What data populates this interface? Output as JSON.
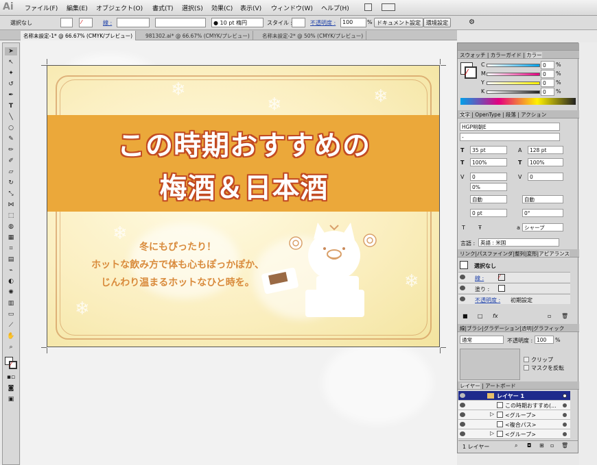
{
  "app": {
    "logo": "Ai"
  },
  "menu": [
    "ファイル(F)",
    "編集(E)",
    "オブジェクト(O)",
    "書式(T)",
    "選択(S)",
    "効果(C)",
    "表示(V)",
    "ウィンドウ(W)",
    "ヘルプ(H)"
  ],
  "control": {
    "selection": "選択なし",
    "stroke_label": "線 :",
    "brush_value": "10 pt 楕円",
    "style_label": "スタイル :",
    "opacity_label": "不透明度 :",
    "opacity_value": "100",
    "percent": "%",
    "doc_setup": "ドキュメント設定",
    "prefs": "環境設定"
  },
  "tabs": [
    {
      "label": "名称未設定-1* @ 66.67% (CMYK/プレビュー)",
      "active": true
    },
    {
      "label": "981302.ai* @ 66.67% (CMYK/プレビュー)",
      "active": false
    },
    {
      "label": "名称未設定-2* @ 50% (CMYK/プレビュー)",
      "active": false
    }
  ],
  "artwork": {
    "title_line1": "この時期おすすめの",
    "title_line2": "梅酒＆日本酒",
    "sub1": "冬にもぴったり！",
    "sub2": "ホットな飲み方で体も心もぽっかぽか、",
    "sub3": "じんわり温まるホットなひと時を。",
    "band_color": "#eba83a",
    "title_outline": "#c24a22",
    "sub_color": "#d98b3c"
  },
  "swatch_panel": {
    "tabs": [
      "スウォッチ",
      "カラーガイド",
      "カラー"
    ],
    "rows": [
      {
        "label": "C",
        "value": "0",
        "color": "#00a0e9"
      },
      {
        "label": "M",
        "value": "0",
        "color": "#e4007f"
      },
      {
        "label": "Y",
        "value": "0",
        "color": "#fff100"
      },
      {
        "label": "K",
        "value": "0",
        "color": "#222222"
      }
    ],
    "percent": "%"
  },
  "char_panel": {
    "tabs": [
      "文字",
      "OpenType",
      "段落",
      "アクション"
    ],
    "font": "HGP明朝E",
    "style": "-",
    "size": "35 pt",
    "leading": "128 pt",
    "hscale": "100%",
    "vscale": "100%",
    "kern": "0",
    "track": "0",
    "tsume": "0%",
    "auto1": "自動",
    "auto2": "自動",
    "baseline": "0 pt",
    "rotate": "0°",
    "aa_label": "a",
    "aa_value": "シャープ",
    "lang_label": "言語 :",
    "lang_value": "英語 : 米国"
  },
  "appearance_panel": {
    "tabs": [
      "リンク",
      "パスファインダ",
      "整列",
      "変形",
      "アピアランス"
    ],
    "none": "選択なし",
    "stroke": "線 :",
    "fill": "塗り :",
    "opacity": "不透明度 :",
    "opacity_value": "初期設定"
  },
  "transparency_panel": {
    "tabs": [
      "線",
      "ブラシ",
      "グラデーション",
      "透明",
      "グラフィック"
    ],
    "mode": "通常",
    "opacity_label": "不透明度 :",
    "opacity_value": "100",
    "percent": "%",
    "clip": "クリップ",
    "invert": "マスクを反転"
  },
  "layers_panel": {
    "tabs": [
      "レイヤー",
      "アートボード"
    ],
    "rows": [
      {
        "name": "レイヤー 1",
        "top": true
      },
      {
        "name": "この時期おすすめ(...",
        "top": false
      },
      {
        "name": "<グループ>",
        "top": false
      },
      {
        "name": "<複合パス>",
        "top": false
      },
      {
        "name": "<グループ>",
        "top": false
      }
    ],
    "footer": "1 レイヤー"
  }
}
